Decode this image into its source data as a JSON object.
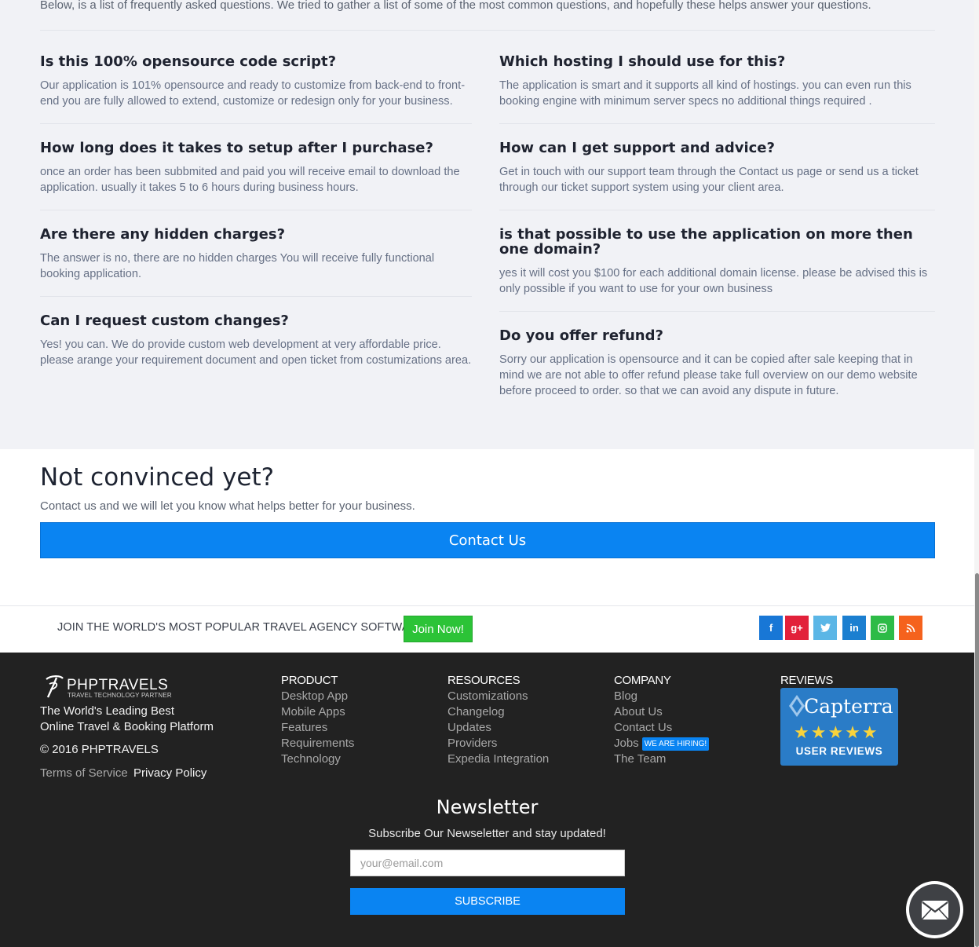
{
  "faq": {
    "intro": "Below, is a list of frequently asked questions. We tried to gather a list of some of the most common questions, and hopefully these helps answer your questions.",
    "left": [
      {
        "q": "Is this 100% opensource code script?",
        "a": "Our application is 101% opensource and ready to customize from back-end to front-end you are fully allowed to extend, customize or redesign only for your business."
      },
      {
        "q": "How long does it takes to setup after I purchase?",
        "a": "once an order has been subbmited and paid you will receive email to download the application. usually it takes 5 to 6 hours during business hours."
      },
      {
        "q": "Are there any hidden charges?",
        "a": "The answer is no, there are no hidden charges You will receive fully functional booking application."
      },
      {
        "q": "Can I request custom changes?",
        "a": "Yes! you can. We do provide custom web development at very affordable price. please arange your requirement document and open ticket from costumizations area."
      }
    ],
    "right": [
      {
        "q": "Which hosting I should use for this?",
        "a": "The application is smart and it supports all kind of hostings. you can even run this booking engine with minimum server specs no additional things required ."
      },
      {
        "q": "How can I get support and advice?",
        "a": "Get in touch with our support team through the Contact us page or send us a ticket through our ticket support system using your client area."
      },
      {
        "q": "is that possible to use the application on more then one domain?",
        "a": "yes it will cost you $100 for each additional domain license. please be advised this is only possible if you want to use for your own business"
      },
      {
        "q": "Do you offer refund?",
        "a": "Sorry our application is opensource and it can be copied after sale keeping that in mind we are not able to offer refund please take full overview on our demo website before proceed to order. so that we can avoid any dispute in future."
      }
    ]
  },
  "convince": {
    "title": "Not convinced yet?",
    "subtitle": "Contact us and we will let you know what helps better for your business.",
    "button": "Contact Us"
  },
  "join": {
    "text": "JOIN THE WORLD'S MOST POPULAR TRAVEL AGENCY SOFTWARE",
    "button": "Join Now!",
    "social": [
      {
        "name": "facebook",
        "glyph": "f",
        "color": "#1877d6"
      },
      {
        "name": "google-plus",
        "glyph": "g+",
        "color": "#e2213a"
      },
      {
        "name": "twitter",
        "glyph": "t",
        "color": "#5bb6e6"
      },
      {
        "name": "linkedin",
        "glyph": "in",
        "color": "#1b7fd0"
      },
      {
        "name": "instagram",
        "glyph": "◎",
        "color": "#2dbb47"
      },
      {
        "name": "rss",
        "glyph": "◉",
        "color": "#f5621d"
      }
    ]
  },
  "footer": {
    "logo_name": "PHPTRAVELS",
    "logo_tag": "TRAVEL TECHNOLOGY PARTNER",
    "tagline_1": "The World's Leading Best",
    "tagline_2": "Online Travel & Booking Platform",
    "copyright": "© 2016 PHPTRAVELS",
    "terms": "Terms of Service",
    "privacy": "Privacy Policy",
    "product": {
      "head": "PRODUCT",
      "links": [
        "Desktop App",
        "Mobile Apps",
        "Features",
        "Requirements",
        "Technology"
      ]
    },
    "resources": {
      "head": "RESOURCES",
      "links": [
        "Customizations",
        "Changelog",
        "Updates",
        "Providers",
        "Expedia Integration"
      ]
    },
    "company": {
      "head": "COMPANY",
      "links": [
        "Blog",
        "About Us",
        "Contact Us",
        "Jobs",
        "The Team"
      ],
      "hiring": "WE ARE HIRING!"
    },
    "reviews": {
      "head": "REVIEWS",
      "brand": "Capterra",
      "stars": "★★★★★",
      "label": "USER REVIEWS"
    }
  },
  "newsletter": {
    "title": "Newsletter",
    "subtitle": "Subscribe Our Newseletter and stay updated!",
    "placeholder": "your@email.com",
    "button": "SUBSCRIBE"
  }
}
